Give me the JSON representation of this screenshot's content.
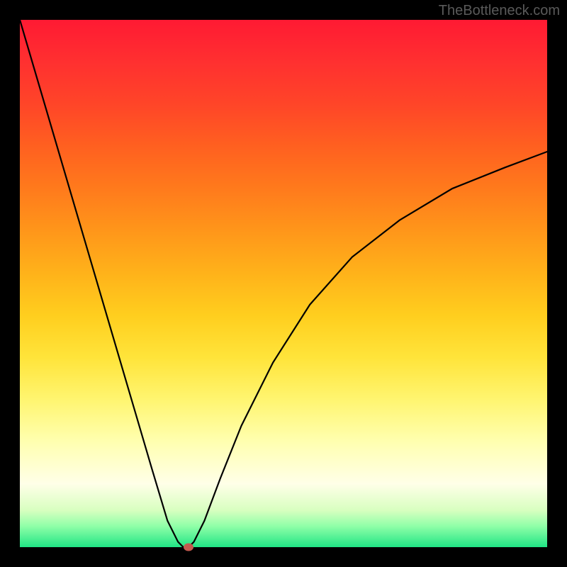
{
  "watermark": "TheBottleneck.com",
  "chart_data": {
    "type": "line",
    "title": "",
    "xlabel": "",
    "ylabel": "",
    "xlim": [
      0,
      1
    ],
    "ylim": [
      0,
      1
    ],
    "background_gradient": {
      "top": "#ff1a33",
      "middle": "#ffe43a",
      "bottom": "#20e585"
    },
    "series": [
      {
        "name": "curve",
        "type": "line",
        "x": [
          0.0,
          0.05,
          0.1,
          0.15,
          0.2,
          0.25,
          0.28,
          0.3,
          0.31,
          0.32,
          0.33,
          0.35,
          0.38,
          0.42,
          0.48,
          0.55,
          0.63,
          0.72,
          0.82,
          0.92,
          1.0
        ],
        "y": [
          1.0,
          0.83,
          0.66,
          0.49,
          0.32,
          0.15,
          0.05,
          0.01,
          0.0,
          0.0,
          0.01,
          0.05,
          0.13,
          0.23,
          0.35,
          0.46,
          0.55,
          0.62,
          0.68,
          0.72,
          0.75
        ]
      }
    ],
    "marker": {
      "x": 0.32,
      "y": 0.0,
      "color": "#c55a4f"
    },
    "frame": {
      "color": "#000000",
      "inner_width": 744,
      "inner_height": 744
    }
  }
}
